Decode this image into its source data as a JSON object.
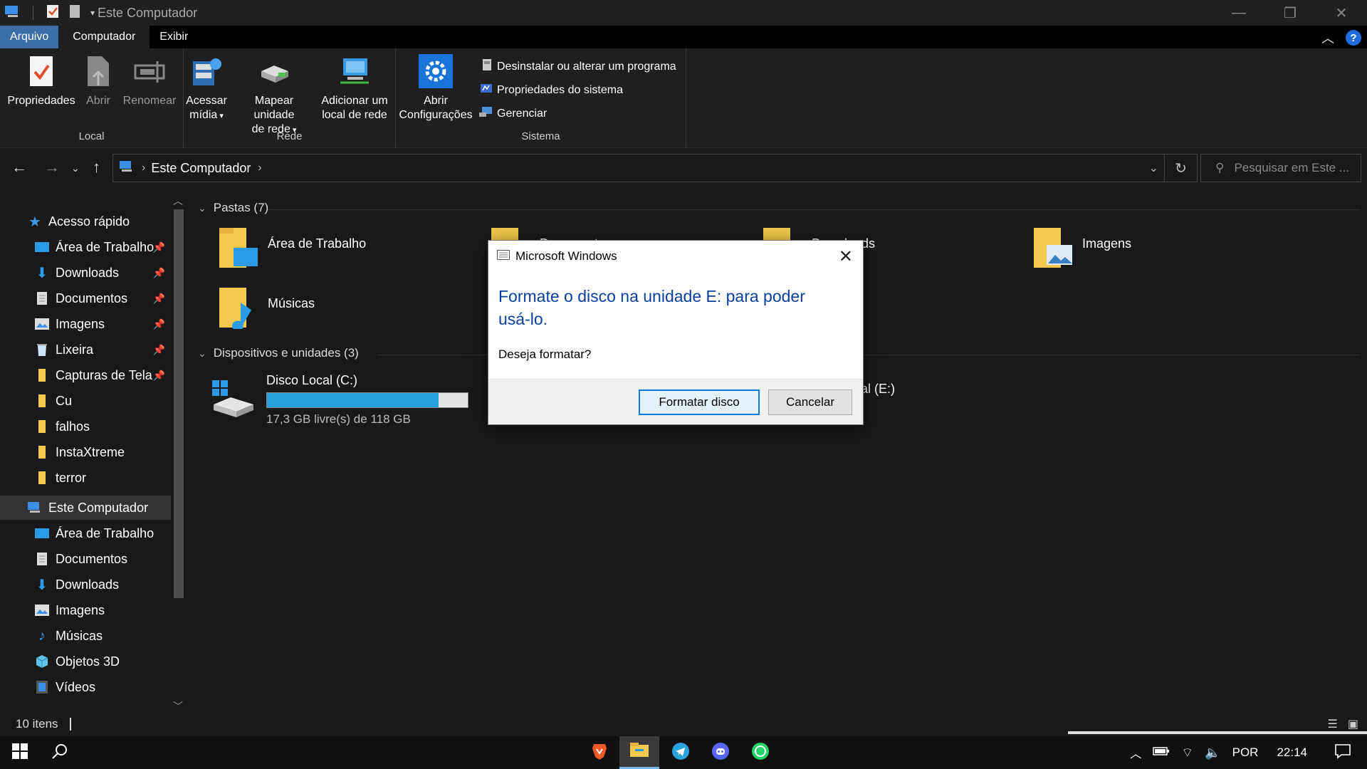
{
  "window": {
    "title": "Este Computador"
  },
  "ribbon_tabs": [
    {
      "label": "Arquivo"
    },
    {
      "label": "Computador"
    },
    {
      "label": "Exibir"
    }
  ],
  "ribbon": {
    "groups": {
      "local": "Local",
      "rede": "Rede",
      "sistema": "Sistema"
    },
    "buttons": {
      "propriedades": "Propriedades",
      "abrir": "Abrir",
      "renomear": "Renomear",
      "acessar_midia_1": "Acessar",
      "acessar_midia_2": "mídia",
      "mapear_1": "Mapear unidade",
      "mapear_2": "de rede",
      "adicionar_1": "Adicionar um",
      "adicionar_2": "local de rede",
      "abrir_config_1": "Abrir",
      "abrir_config_2": "Configurações",
      "desinstalar": "Desinstalar ou alterar um programa",
      "propriedades_sistema": "Propriedades do sistema",
      "gerenciar": "Gerenciar"
    }
  },
  "address": {
    "crumb": "Este Computador",
    "search_placeholder": "Pesquisar em Este ..."
  },
  "sidebar": {
    "quick_access": "Acesso rápido",
    "quick_items": [
      {
        "label": "Área de Trabalho",
        "pinned": true
      },
      {
        "label": "Downloads",
        "pinned": true
      },
      {
        "label": "Documentos",
        "pinned": true
      },
      {
        "label": "Imagens",
        "pinned": true
      },
      {
        "label": "Lixeira",
        "pinned": true
      },
      {
        "label": "Capturas de Tela",
        "pinned": true
      },
      {
        "label": "Cu",
        "pinned": false
      },
      {
        "label": "falhos",
        "pinned": false
      },
      {
        "label": "InstaXtreme",
        "pinned": false
      },
      {
        "label": "terror",
        "pinned": false
      }
    ],
    "this_pc": "Este Computador",
    "pc_items": [
      {
        "label": "Área de Trabalho"
      },
      {
        "label": "Documentos"
      },
      {
        "label": "Downloads"
      },
      {
        "label": "Imagens"
      },
      {
        "label": "Músicas"
      },
      {
        "label": "Objetos 3D"
      },
      {
        "label": "Vídeos"
      }
    ]
  },
  "content": {
    "folders_header": "Pastas (7)",
    "folders": [
      {
        "label": "Área de Trabalho"
      },
      {
        "label": "Documentos"
      },
      {
        "label": "Downloads"
      },
      {
        "label": "Imagens"
      },
      {
        "label": "Músicas"
      }
    ],
    "devices_header": "Dispositivos e unidades (3)",
    "drive_c": {
      "name": "Disco Local (C:)",
      "space": "17,3 GB livre(s) de 118 GB",
      "used_fraction": 0.853
    },
    "drive_e_partial": "al (E:)"
  },
  "status": {
    "count": "10 itens"
  },
  "dialog": {
    "title": "Microsoft Windows",
    "message": "Formate o disco na unidade E: para poder usá-lo.",
    "question": "Deseja formatar?",
    "primary_button": "Formatar disco",
    "cancel_button": "Cancelar"
  },
  "taskbar": {
    "language": "POR",
    "time": "22:14"
  },
  "colors": {
    "accent": "#0078d7",
    "file_tab": "#3a6ea5",
    "progress": "#26a0da",
    "dialog_heading": "#0a3fa0"
  }
}
